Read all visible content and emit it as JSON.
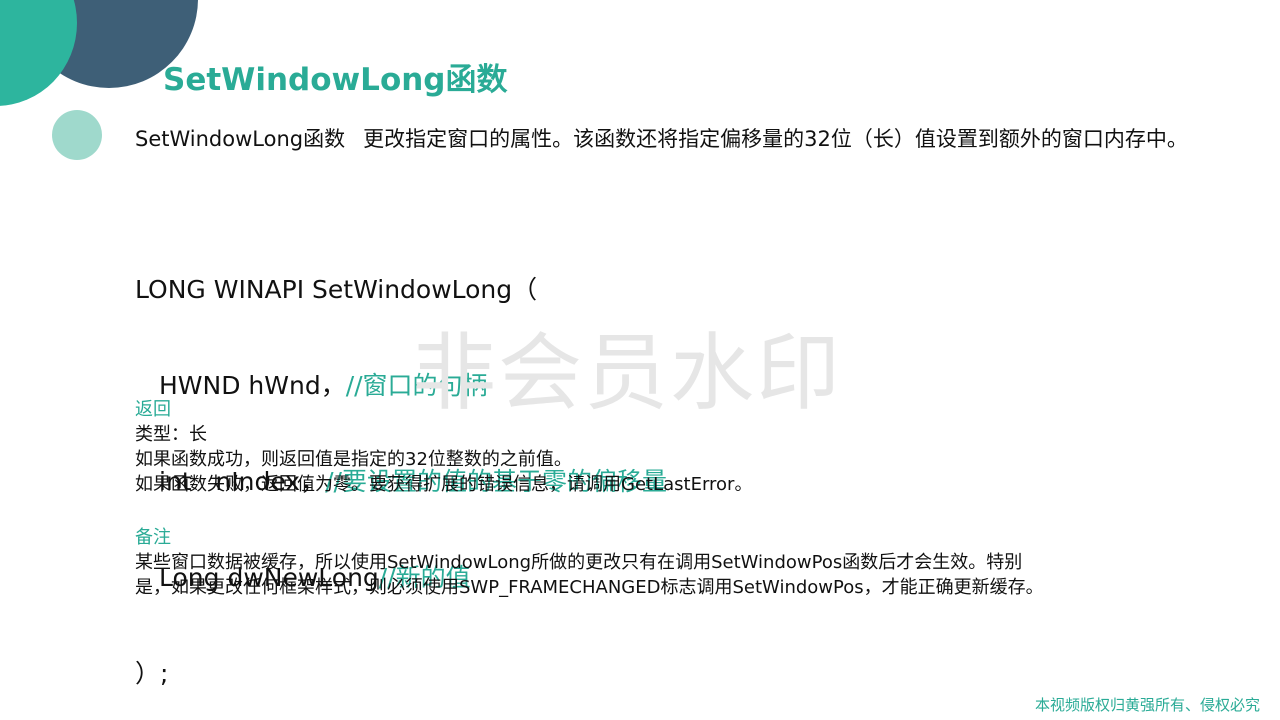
{
  "title": "SetWindowLong函数",
  "description": {
    "name": "SetWindowLong函数",
    "text": "更改指定窗口的属性。该函数还将指定偏移量的32位（长）值设置到额外的窗口内存中。"
  },
  "signature": {
    "open": "LONG WINAPI SetWindowLong（",
    "params": [
      {
        "code": "HWND hWnd，",
        "comment": "//窗口的句柄"
      },
      {
        "code": "int   nIndex，",
        "comment": "//要设置的值的基于零的偏移量"
      },
      {
        "code": "Long dwNewLong",
        "comment": "//新的值"
      }
    ],
    "close": "）;"
  },
  "returns": {
    "heading": "返回",
    "lines": [
      "类型：长",
      "如果函数成功，则返回值是指定的32位整数的之前值。",
      "如果函数失败，返回值为零。要获得扩展的错误信息，请调用GetLastError。"
    ]
  },
  "remarks": {
    "heading": "备注",
    "lines": [
      "某些窗口数据被缓存，所以使用SetWindowLong所做的更改只有在调用SetWindowPos函数后才会生效。特别",
      "是，如果更改任何框架样式，则必须使用SWP_FRAMECHANGED标志调用SetWindowPos，才能正确更新缓存。"
    ]
  },
  "watermark": "非会员水印",
  "footer": "本视频版权归黄强所有、侵权必究",
  "colors": {
    "accent": "#2aab96",
    "circle_dark": "#3e5f77",
    "circle_teal": "#2db59e",
    "circle_light": "#9fd9cc"
  }
}
